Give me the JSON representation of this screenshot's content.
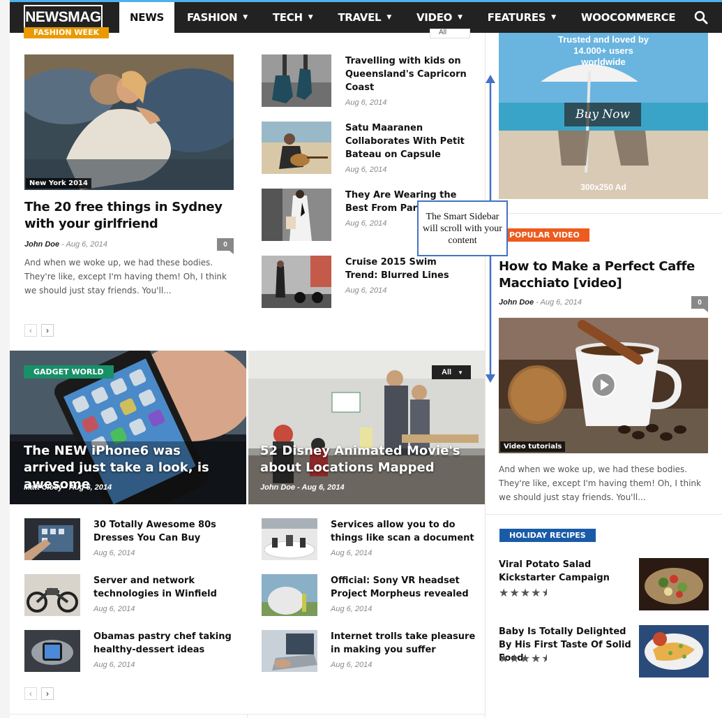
{
  "header": {
    "logo": "NEWSMAG",
    "menu": [
      {
        "label": "NEWS",
        "active": true,
        "dropdown": false
      },
      {
        "label": "FASHION",
        "dropdown": true
      },
      {
        "label": "TECH",
        "dropdown": true
      },
      {
        "label": "TRAVEL",
        "dropdown": true
      },
      {
        "label": "VIDEO",
        "dropdown": true
      },
      {
        "label": "FEATURES",
        "dropdown": true
      },
      {
        "label": "WOOCOMMERCE",
        "dropdown": false
      }
    ],
    "search_icon": "search-icon"
  },
  "fashion_block": {
    "category": "FASHION WEEK",
    "filter": "All",
    "main": {
      "image_tag": "New York 2014",
      "title": "The 20 free things in Sydney with your girlfriend",
      "author": "John Doe",
      "date": "Aug 6, 2014",
      "comments": "0",
      "excerpt": "And when we woke up, we had these bodies. They're like, except I'm having them! Oh, I think we should just stay friends. You'll..."
    },
    "list": [
      {
        "title": "Travelling with kids on Queensland's Capricorn Coast",
        "date": "Aug 6, 2014"
      },
      {
        "title": "Satu Maaranen Collaborates With Petit Bateau on Capsule",
        "date": "Aug 6, 2014"
      },
      {
        "title": "They Are Wearing the Best From Paris Week",
        "date": "Aug 6, 2014"
      },
      {
        "title": "Cruise 2015 Swim Trend: Blurred Lines",
        "date": "Aug 6, 2014"
      }
    ],
    "pager": [
      "‹",
      "›"
    ]
  },
  "gadget_block": {
    "category": "GADGET WORLD",
    "filter": "All",
    "features": [
      {
        "title": "The NEW iPhone6 was arrived just take a look, is awesome",
        "author": "Matt Cloey",
        "date": "Aug 6, 2014"
      },
      {
        "title": "52 Disney Animated Movie's about Locations Mapped",
        "author": "John Doe",
        "date": "Aug 6, 2014"
      }
    ],
    "left_list": [
      {
        "title": "30 Totally Awesome 80s Dresses You Can Buy",
        "date": "Aug 6, 2014"
      },
      {
        "title": "Server and network technologies in Winfield",
        "date": "Aug 6, 2014"
      },
      {
        "title": "Obamas pastry chef taking healthy-dessert ideas",
        "date": "Aug 6, 2014"
      }
    ],
    "right_list": [
      {
        "title": "Services allow you to do things like scan a document",
        "date": "Aug 6, 2014"
      },
      {
        "title": "Official: Sony VR headset Project Morpheus revealed",
        "date": "Aug 6, 2014"
      },
      {
        "title": "Internet trolls take pleasure in making you suffer",
        "date": "Aug 6, 2014"
      }
    ],
    "pager": [
      "‹",
      "›"
    ]
  },
  "sidebar": {
    "ad": {
      "tagline": "Trusted and loved by 14.000+ users worldwide",
      "button": "Buy Now",
      "size": "300x250 Ad"
    },
    "video": {
      "category": "POPULAR VIDEO",
      "title": "How to Make a Perfect Caffe Macchiato [video]",
      "author": "John Doe",
      "date": "Aug 6, 2014",
      "comments": "0",
      "image_tag": "Video tutorials",
      "excerpt": "And when we woke up, we had these bodies. They're like, except I'm having them! Oh, I think we should just stay friends. You'll..."
    },
    "recipes": {
      "category": "HOLIDAY RECIPES",
      "items": [
        {
          "title": "Viral Potato Salad Kickstarter Campaign",
          "rating": 4.5
        },
        {
          "title": "Baby Is Totally Delighted By His First Taste Of Solid Food",
          "rating": 4.5
        }
      ]
    }
  },
  "callout": {
    "text": "The Smart Sidebar will scroll with your content"
  },
  "colors": {
    "nav_bg": "#222222",
    "accent_blue": "#4db2ec",
    "fashion": "#ea9a00",
    "gadget": "#189068",
    "video": "#ed5b1e",
    "recipes": "#1a5ba8",
    "callout_border": "#4472c4"
  }
}
